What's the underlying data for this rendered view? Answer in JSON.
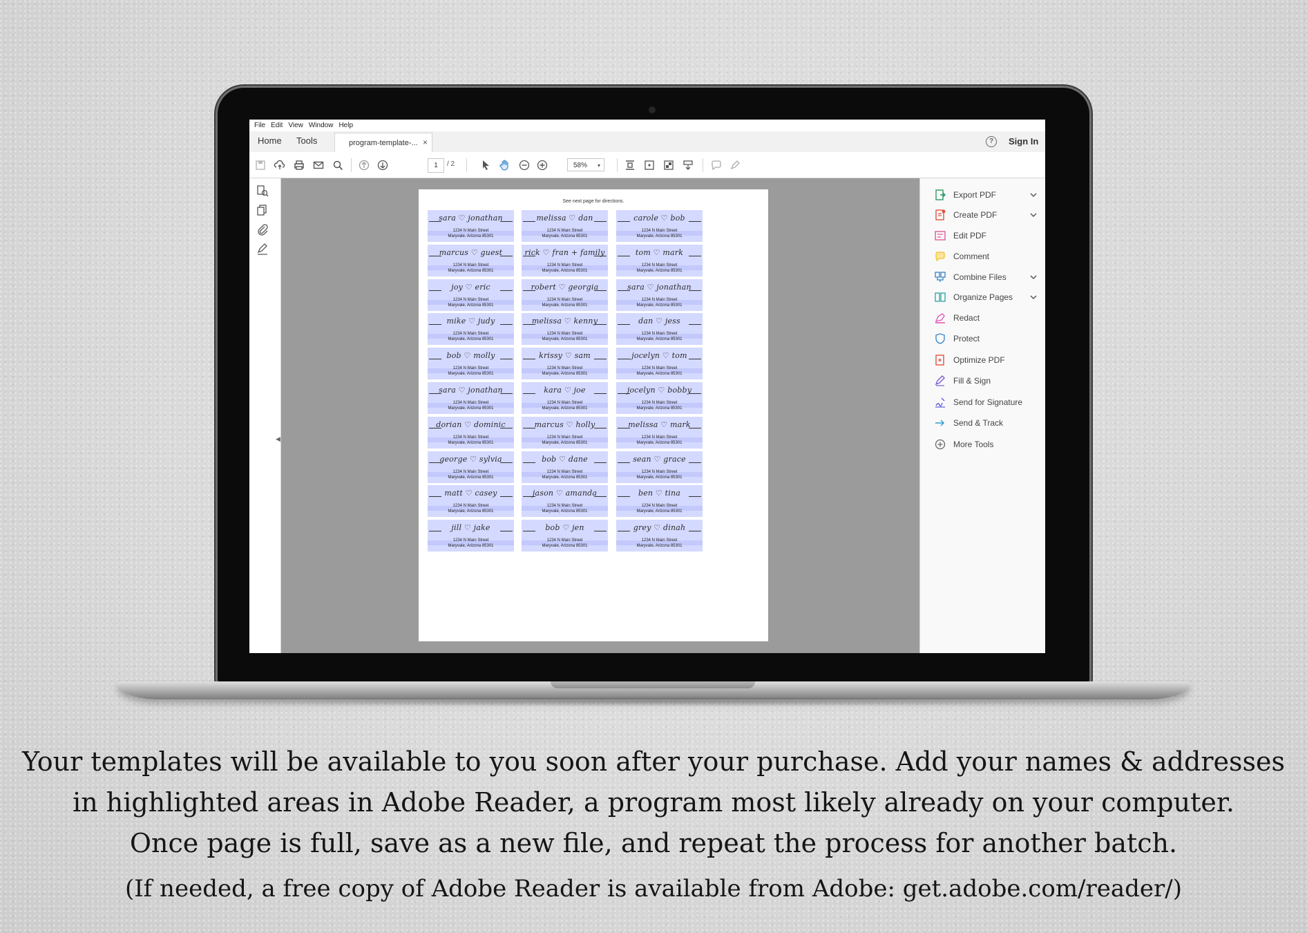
{
  "menu": [
    "File",
    "Edit",
    "View",
    "Window",
    "Help"
  ],
  "tabs": {
    "home": "Home",
    "tools": "Tools",
    "document": "program-template-...",
    "close": "×"
  },
  "account": {
    "help": "?",
    "sign_in": "Sign In"
  },
  "toolbar": {
    "page_current": "1",
    "page_total": "/ 2",
    "zoom": "58%",
    "zoom_caret": "▾"
  },
  "colors": {
    "label_fill": "#d4d9ff",
    "label_band": "#c3c9fb",
    "doc_bg": "#9b9b9b"
  },
  "page": {
    "note": "See next page for directions.",
    "address_line1": "1234 N Main Street",
    "address_line2": "Maryvale, Arizona 85301",
    "labels": [
      [
        "sara ♡ jonathan",
        "melissa ♡ dan",
        "carole ♡ bob"
      ],
      [
        "marcus ♡ guest",
        "rick ♡ fran + family",
        "tom ♡ mark"
      ],
      [
        "joy ♡ eric",
        "robert ♡ georgia",
        "sara ♡ jonathan"
      ],
      [
        "mike ♡ judy",
        "melissa ♡ kenny",
        "dan ♡ jess"
      ],
      [
        "bob ♡ molly",
        "krissy ♡ sam",
        "jocelyn ♡ tom"
      ],
      [
        "sara ♡ jonathan",
        "kara ♡ joe",
        "jocelyn ♡ bobby"
      ],
      [
        "dorian ♡ dominic",
        "marcus ♡ holly",
        "melissa ♡ mark"
      ],
      [
        "george ♡ sylvia",
        "bob ♡ dane",
        "sean ♡ grace"
      ],
      [
        "matt ♡ casey",
        "jason ♡ amanda",
        "ben ♡ tina"
      ],
      [
        "jill ♡ jake",
        "bob ♡ jen",
        "grey ♡ dinah"
      ]
    ]
  },
  "tools": [
    {
      "label": "Export PDF",
      "icon": "export-pdf-icon",
      "color": "#2c9a64",
      "chevron": true
    },
    {
      "label": "Create PDF",
      "icon": "create-pdf-icon",
      "color": "#e0533f",
      "chevron": true
    },
    {
      "label": "Edit PDF",
      "icon": "edit-pdf-icon",
      "color": "#e2579a",
      "chevron": false
    },
    {
      "label": "Comment",
      "icon": "comment-icon",
      "color": "#f2c230",
      "chevron": false
    },
    {
      "label": "Combine Files",
      "icon": "combine-files-icon",
      "color": "#2f80c4",
      "chevron": true
    },
    {
      "label": "Organize Pages",
      "icon": "organize-pages-icon",
      "color": "#2aa1a1",
      "chevron": true
    },
    {
      "label": "Redact",
      "icon": "redact-icon",
      "color": "#e25bb8",
      "chevron": false
    },
    {
      "label": "Protect",
      "icon": "protect-icon",
      "color": "#3b8bd1",
      "chevron": false
    },
    {
      "label": "Optimize PDF",
      "icon": "optimize-pdf-icon",
      "color": "#e0533f",
      "chevron": false
    },
    {
      "label": "Fill & Sign",
      "icon": "fill-sign-icon",
      "color": "#7a5cd6",
      "chevron": false
    },
    {
      "label": "Send for Signature",
      "icon": "send-signature-icon",
      "color": "#5b5fd6",
      "chevron": false
    },
    {
      "label": "Send & Track",
      "icon": "send-track-icon",
      "color": "#2f9ccf",
      "chevron": false
    },
    {
      "label": "More Tools",
      "icon": "more-tools-icon",
      "color": "#666666",
      "chevron": false
    }
  ],
  "caption": {
    "line1": "Your templates will be available to you soon after your purchase.  Add your names & addresses",
    "line2": "in highlighted areas in Adobe Reader, a program most likely already on your computer.",
    "line3": "Once page is full, save as a new file, and repeat the process for another batch.",
    "line4": "(If needed, a free copy of Adobe Reader is available from Adobe: get.adobe.com/reader/)"
  }
}
